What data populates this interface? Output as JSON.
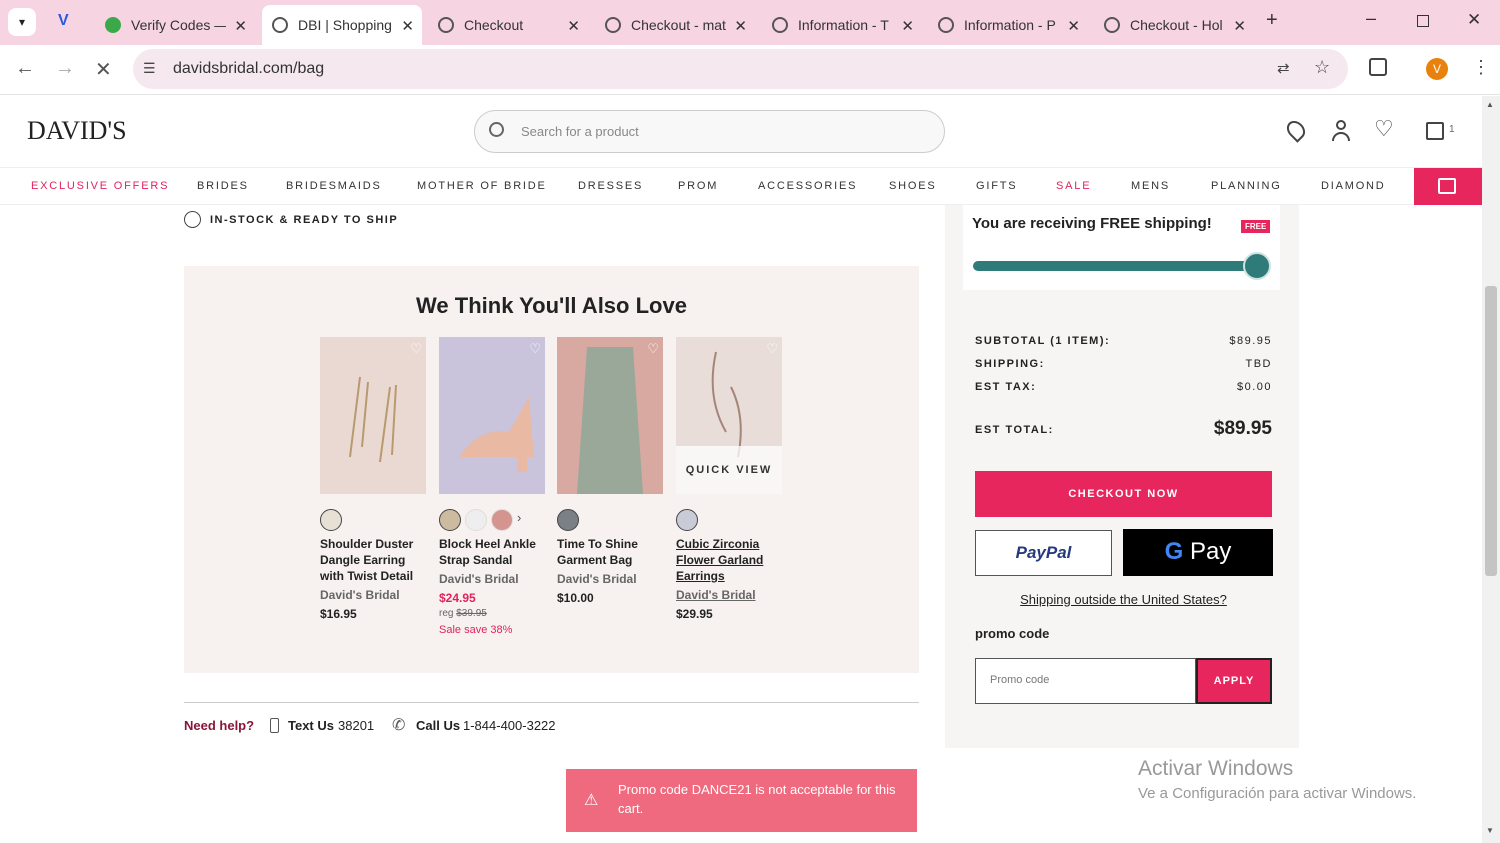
{
  "browser": {
    "tabs": [
      {
        "label": "Verify Codes —"
      },
      {
        "label": "DBI | Shopping"
      },
      {
        "label": "Checkout"
      },
      {
        "label": "Checkout - mat"
      },
      {
        "label": "Information - T"
      },
      {
        "label": "Information - P"
      },
      {
        "label": "Checkout - Hol"
      }
    ],
    "url": "davidsbridal.com/bag",
    "profile_initial": "V"
  },
  "header": {
    "logo": "DAVID'S",
    "search_placeholder": "Search for a product",
    "cart_count": "1"
  },
  "menu": [
    "EXCLUSIVE OFFERS",
    "BRIDES",
    "BRIDESMAIDS",
    "MOTHER OF BRIDE",
    "DRESSES",
    "PROM",
    "ACCESSORIES",
    "SHOES",
    "GIFTS",
    "SALE",
    "MENS",
    "PLANNING",
    "DIAMOND"
  ],
  "instock": "IN-STOCK & READY TO SHIP",
  "recommend": {
    "title": "We Think You'll Also Love",
    "quick_view": "QUICK VIEW",
    "products": [
      {
        "name": "Shoulder Duster Dangle Earring with Twist Detail",
        "brand": "David's Bridal",
        "price": "$16.95"
      },
      {
        "name": "Block Heel Ankle Strap Sandal",
        "brand": "David's Bridal",
        "price": "$24.95",
        "reg_label": "reg",
        "reg_price": "$39.95",
        "sale": "Sale save 38%"
      },
      {
        "name": "Time To Shine Garment Bag",
        "brand": "David's Bridal",
        "price": "$10.00"
      },
      {
        "name": "Cubic Zirconia Flower Garland Earrings",
        "brand": "David's Bridal",
        "price": "$29.95"
      }
    ]
  },
  "help": {
    "need": "Need help?",
    "text_label": "Text Us",
    "text_num": "38201",
    "call_label": "Call Us",
    "call_num": "1-844-400-3222"
  },
  "toast": "Promo code DANCE21 is not acceptable for this cart.",
  "summary": {
    "free_ship": "You are receiving FREE shipping!",
    "free_badge": "FREE",
    "subtotal_label": "SUBTOTAL (1 ITEM):",
    "subtotal": "$89.95",
    "shipping_label": "SHIPPING:",
    "shipping": "TBD",
    "tax_label": "EST TAX:",
    "tax": "$0.00",
    "total_label": "EST TOTAL:",
    "total": "$89.95",
    "checkout": "CHECKOUT NOW",
    "paypal": "PayPal",
    "gpay": "Pay",
    "outside": "Shipping outside the United States?",
    "promo_heading": "promo code",
    "promo_placeholder": "Promo code",
    "apply": "APPLY"
  },
  "watermark": {
    "title": "Activar Windows",
    "sub": "Ve a Configuración para activar Windows."
  }
}
